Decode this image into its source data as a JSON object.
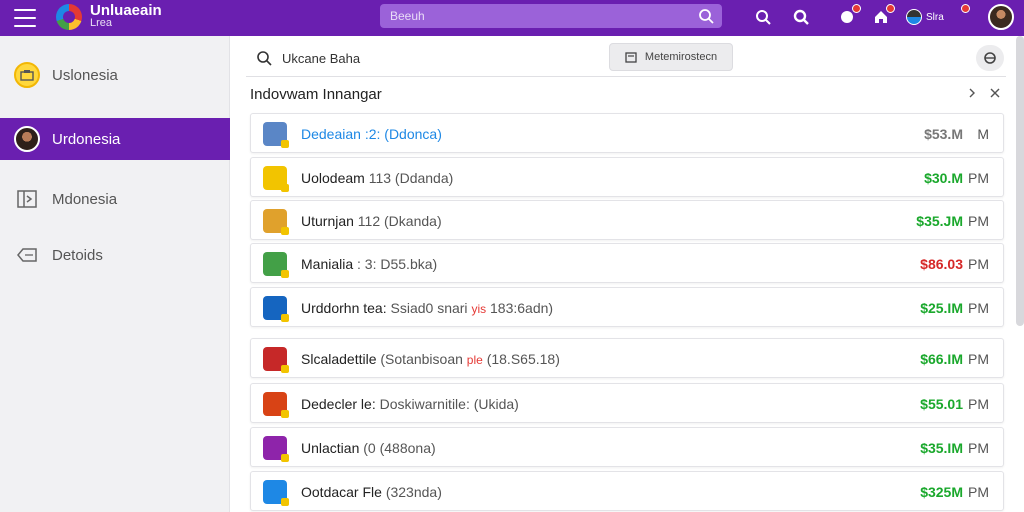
{
  "app": {
    "title_line1": "Unluaeain",
    "title_line2": "Lrea",
    "accent_color": "#6a1fb0"
  },
  "search": {
    "placeholder": "Beeuh"
  },
  "topbar_chip": {
    "label": "Slra"
  },
  "sidebar": {
    "items": [
      {
        "label": "Uslonesia",
        "icon": "folder-badge-icon"
      },
      {
        "label": "Urdonesia",
        "icon": "avatar-icon"
      },
      {
        "label": "Mdonesia",
        "icon": "window-icon"
      },
      {
        "label": "Detoids",
        "icon": "tag-icon"
      }
    ]
  },
  "toolbar": {
    "search_text": "Ukcane Baha",
    "button_label": "Metemirostecn"
  },
  "list": {
    "title": "Indovwam Innangar",
    "rows": [
      {
        "name": "Dedeaian :2: (Ddonca)",
        "sub": "",
        "highlight": "",
        "tail": "",
        "amount": "$53.M",
        "pm": "M",
        "amount_color": "#777777",
        "icon_color": "#5a86c6"
      },
      {
        "name": "Uolodeam",
        "sub": " 113 (Ddanda)",
        "highlight": "",
        "tail": "",
        "amount": "$30.M",
        "pm": "PM",
        "amount_color": "#1aa82c",
        "icon_color": "#f2c400"
      },
      {
        "name": "Uturnjan",
        "sub": " 112 (Dkanda)",
        "highlight": "",
        "tail": "",
        "amount": "$35.JM",
        "pm": "PM",
        "amount_color": "#1aa82c",
        "icon_color": "#e0a12c"
      },
      {
        "name": "Manialia",
        "sub": " : 3: D55.bka)",
        "highlight": "",
        "tail": "",
        "amount": "$86.03",
        "pm": "PM",
        "amount_color": "#d62828",
        "icon_color": "#43a047"
      },
      {
        "name": "Urddorhn tea:",
        "sub": " Ssiad0 snari ",
        "highlight": "yis",
        "tail": " 183:6adn)",
        "amount": "$25.IM",
        "pm": "PM",
        "amount_color": "#1aa82c",
        "icon_color": "#1565c0"
      },
      {
        "name": "Slcaladettile",
        "sub": " (Sotanbisoan ",
        "highlight": "ple",
        "tail": " (18.S65.18)",
        "amount": "$66.IM",
        "pm": "PM",
        "amount_color": "#1aa82c",
        "icon_color": "#c62828"
      },
      {
        "name": "Dedecler le:",
        "sub": " Doskiwarnitile: (Ukida)",
        "highlight": "",
        "tail": "",
        "amount": "$55.01",
        "pm": "PM",
        "amount_color": "#1aa82c",
        "icon_color": "#d84315"
      },
      {
        "name": "Unlactian",
        "sub": " (0 (488ona)",
        "highlight": "",
        "tail": "",
        "amount": "$35.IM",
        "pm": "PM",
        "amount_color": "#1aa82c",
        "icon_color": "#8e24aa"
      },
      {
        "name": "Ootdacar Fle",
        "sub": " (323nda)",
        "highlight": "",
        "tail": "",
        "amount": "$325M",
        "pm": "PM",
        "amount_color": "#1aa82c",
        "icon_color": "#1e88e5"
      }
    ]
  }
}
